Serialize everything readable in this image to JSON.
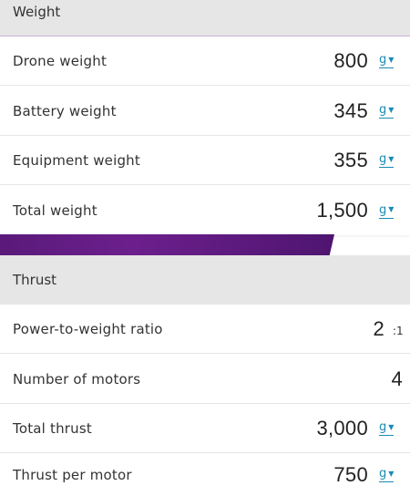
{
  "weight_section": {
    "title": "Weight",
    "rows": [
      {
        "label": "Drone weight",
        "value": "800",
        "unit": "g"
      },
      {
        "label": "Battery weight",
        "value": "345",
        "unit": "g"
      },
      {
        "label": "Equipment weight",
        "value": "355",
        "unit": "g"
      },
      {
        "label": "Total weight",
        "value": "1,500",
        "unit": "g"
      }
    ]
  },
  "thrust_section": {
    "title": "Thrust",
    "rows": [
      {
        "label": "Power-to-weight ratio",
        "value": "2",
        "unit": ":1"
      },
      {
        "label": "Number of motors",
        "value": "4"
      },
      {
        "label": "Total thrust",
        "value": "3,000",
        "unit": "g"
      },
      {
        "label": "Thrust per motor",
        "value": "750",
        "unit": "g"
      }
    ]
  },
  "colors": {
    "link_accent": "#1a8bb4",
    "section_background": "#e6e6e6",
    "purple_band": "#5a1a7a"
  },
  "icons": {
    "unit_dropdown": "caret-down-icon"
  }
}
